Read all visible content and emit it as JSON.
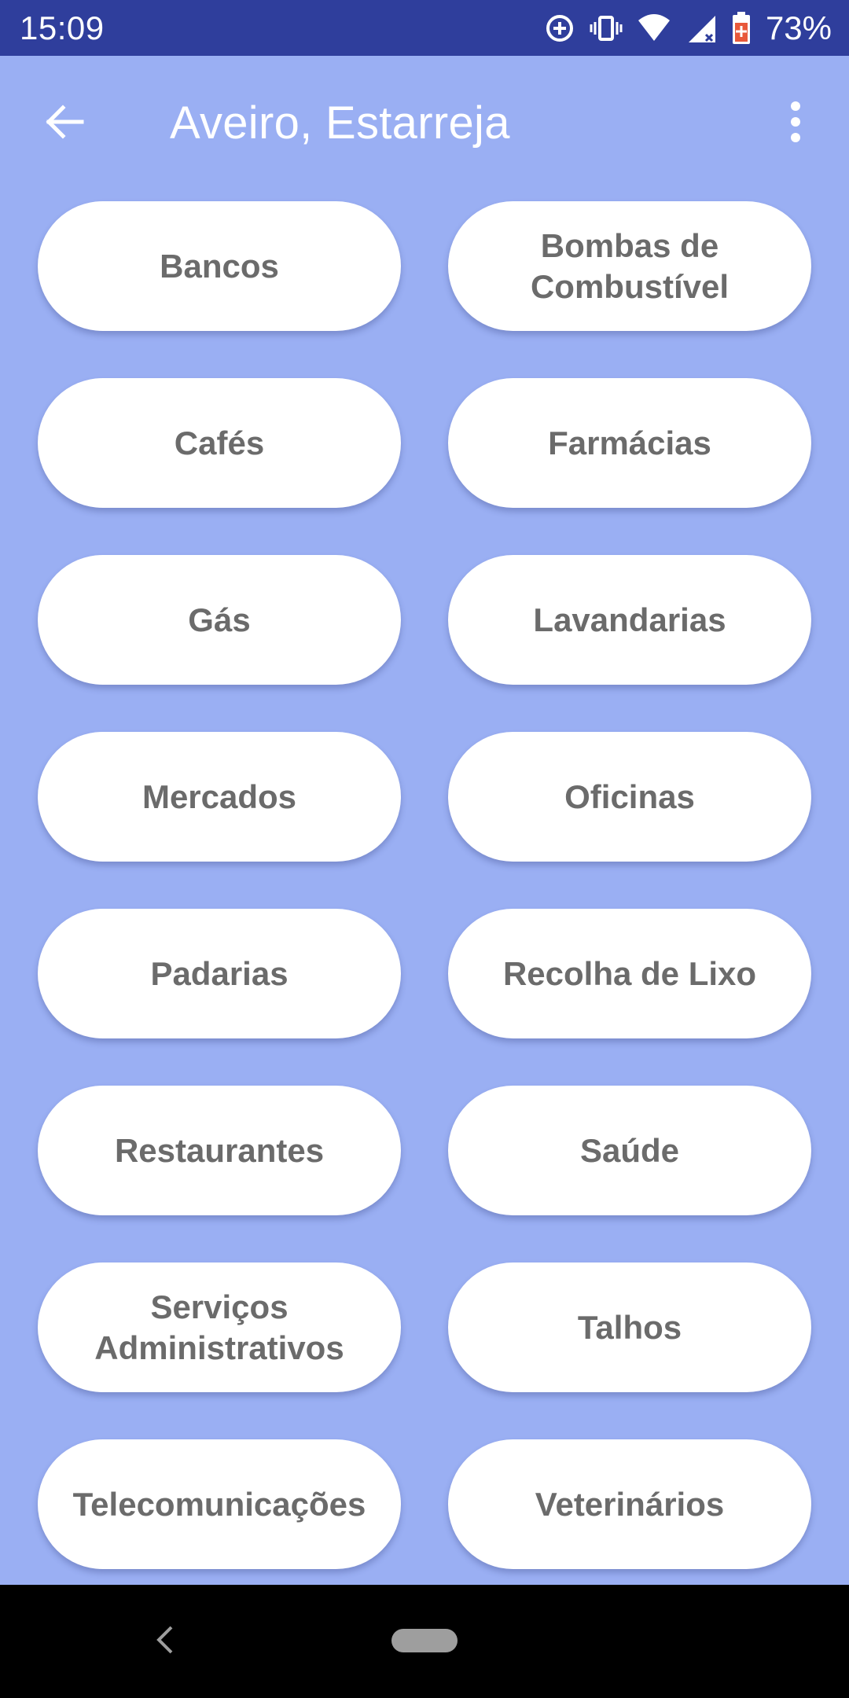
{
  "status_bar": {
    "time": "15:09",
    "battery_percent": "73%",
    "icons": [
      "data-saver-icon",
      "vibrate-icon",
      "wifi-icon",
      "signal-icon",
      "battery-icon"
    ]
  },
  "app_bar": {
    "title": "Aveiro, Estarreja",
    "back_icon": "arrow-back-icon",
    "menu_icon": "more-vert-icon"
  },
  "categories": [
    "Bancos",
    "Bombas de Combustível",
    "Cafés",
    "Farmácias",
    "Gás",
    "Lavandarias",
    "Mercados",
    "Oficinas",
    "Padarias",
    "Recolha de Lixo",
    "Restaurantes",
    "Saúde",
    "Serviços Administrativos",
    "Talhos",
    "Telecomunicações",
    "Veterinários"
  ],
  "colors": {
    "background": "#9AAFF3",
    "status_bar": "#2F3E9C",
    "button_bg": "#FFFFFF",
    "button_text": "#6B6B6B"
  }
}
